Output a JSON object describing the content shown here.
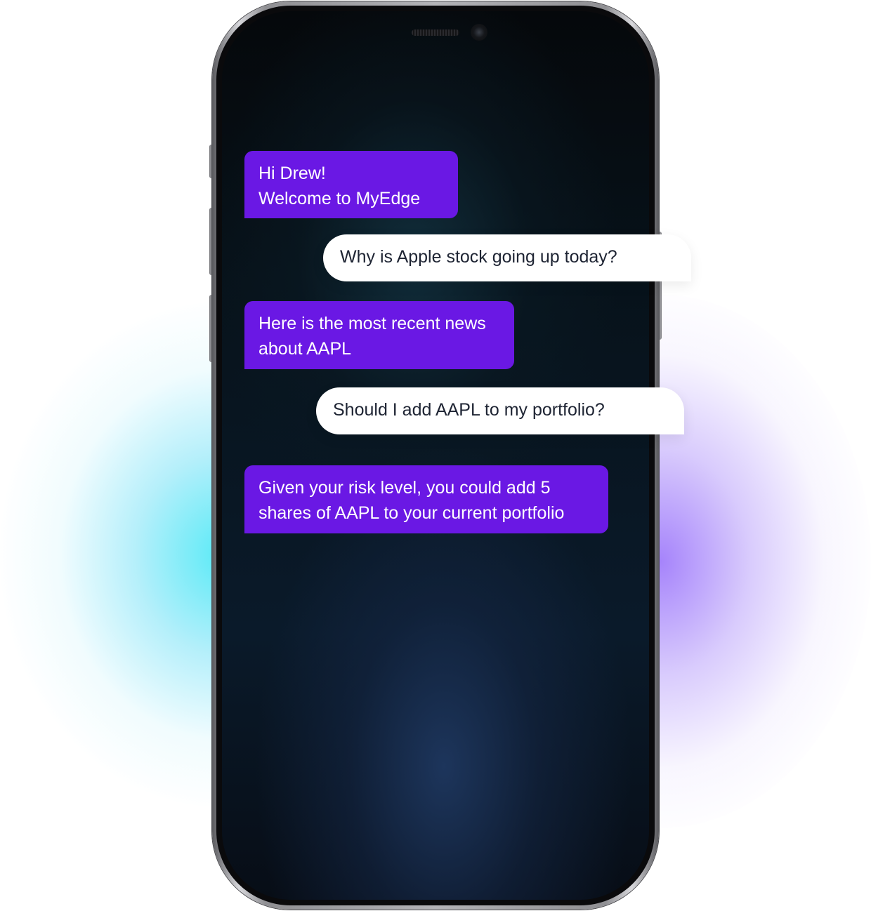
{
  "chat": {
    "messages": [
      {
        "role": "assistant",
        "text": "Hi Drew!\nWelcome to MyEdge"
      },
      {
        "role": "user",
        "text": "Why is Apple stock going up today?"
      },
      {
        "role": "assistant",
        "text": "Here is the most recent news\nabout AAPL"
      },
      {
        "role": "user",
        "text": "Should I add AAPL to my portfolio?"
      },
      {
        "role": "assistant",
        "text": "Given your risk level, you could add 5\nshares of AAPL to your current portfolio"
      }
    ]
  },
  "colors": {
    "assistant_bubble": "#6a18e4",
    "assistant_text": "#ffffff",
    "user_bubble": "#ffffff",
    "user_text": "#1e2433",
    "glow_left": "#3ce6f5",
    "glow_right": "#966efa"
  }
}
